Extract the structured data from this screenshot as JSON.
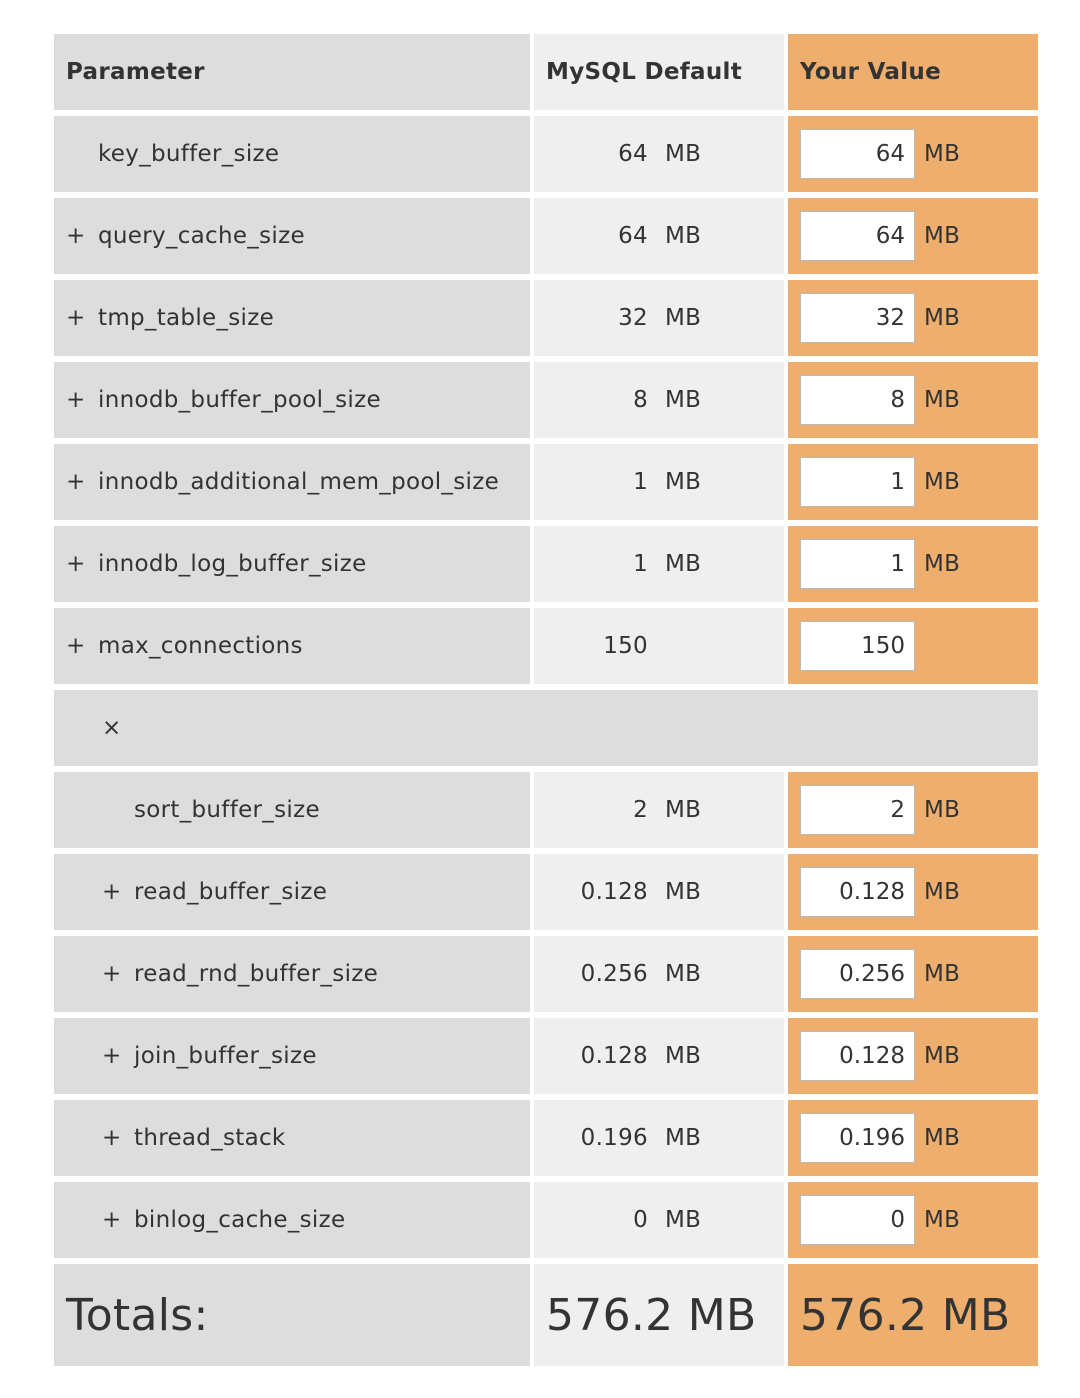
{
  "header": {
    "parameter": "Parameter",
    "default": "MySQL Default",
    "value": "Your Value"
  },
  "global_rows": [
    {
      "prefix": "",
      "name": "key_buffer_size",
      "default": "64",
      "unit": "MB",
      "value": "64"
    },
    {
      "prefix": "+",
      "name": "query_cache_size",
      "default": "64",
      "unit": "MB",
      "value": "64"
    },
    {
      "prefix": "+",
      "name": "tmp_table_size",
      "default": "32",
      "unit": "MB",
      "value": "32"
    },
    {
      "prefix": "+",
      "name": "innodb_buffer_pool_size",
      "default": "8",
      "unit": "MB",
      "value": "8"
    },
    {
      "prefix": "+",
      "name": "innodb_additional_mem_pool_size",
      "default": "1",
      "unit": "MB",
      "value": "1"
    },
    {
      "prefix": "+",
      "name": "innodb_log_buffer_size",
      "default": "1",
      "unit": "MB",
      "value": "1"
    },
    {
      "prefix": "+",
      "name": "max_connections",
      "default": "150",
      "unit": "",
      "value": "150"
    }
  ],
  "multiplier_symbol": "×",
  "thread_rows": [
    {
      "prefix": "",
      "name": "sort_buffer_size",
      "default": "2",
      "unit": "MB",
      "value": "2"
    },
    {
      "prefix": "+",
      "name": "read_buffer_size",
      "default": "0.128",
      "unit": "MB",
      "value": "0.128"
    },
    {
      "prefix": "+",
      "name": "read_rnd_buffer_size",
      "default": "0.256",
      "unit": "MB",
      "value": "0.256"
    },
    {
      "prefix": "+",
      "name": "join_buffer_size",
      "default": "0.128",
      "unit": "MB",
      "value": "0.128"
    },
    {
      "prefix": "+",
      "name": "thread_stack",
      "default": "0.196",
      "unit": "MB",
      "value": "0.196"
    },
    {
      "prefix": "+",
      "name": "binlog_cache_size",
      "default": "0",
      "unit": "MB",
      "value": "0"
    }
  ],
  "totals": {
    "label": "Totals:",
    "default_total": "576.2 MB",
    "your_total": "576.2 MB"
  },
  "colors": {
    "value_column": "#eeaf6e",
    "parameter_column": "#dddddd",
    "default_column": "#efefef"
  }
}
